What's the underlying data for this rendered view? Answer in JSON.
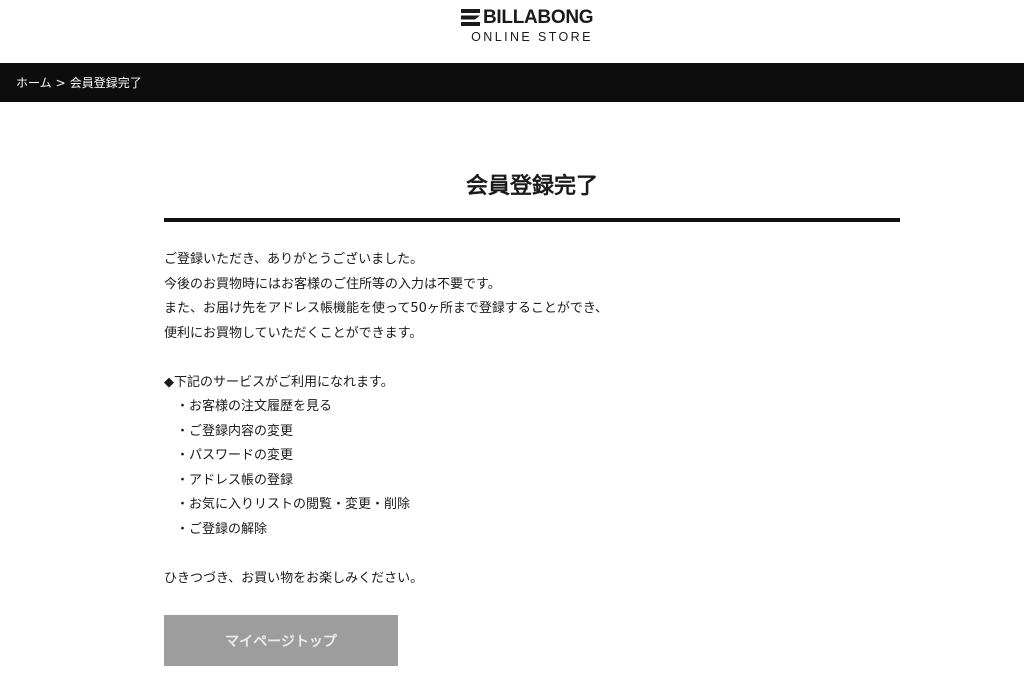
{
  "header": {
    "logo_name": "BILLABONG",
    "logo_sub": "ONLINE STORE"
  },
  "breadcrumb": {
    "home": "ホーム",
    "separator": ">",
    "current": "会員登録完了"
  },
  "main": {
    "title": "会員登録完了",
    "intro_lines": [
      "ご登録いただき、ありがとうございました。",
      "今後のお買物時にはお客様のご住所等の入力は不要です。",
      "また、お届け先をアドレス帳機能を使って50ヶ所まで登録することができ、",
      "便利にお買物していただくことができます。"
    ],
    "services_heading": "◆下記のサービスがご利用になれます。",
    "services": [
      "・お客様の注文履歴を見る",
      "・ご登録内容の変更",
      "・パスワードの変更",
      "・アドレス帳の登録",
      "・お気に入りリストの閲覧・変更・削除",
      "・ご登録の解除"
    ],
    "closing": "ひきつづき、お買い物をお楽しみください。",
    "button_label": "マイページトップ"
  },
  "colors": {
    "breadcrumb_bg": "#0d0d0d",
    "button_bg": "#9d9d9d",
    "button_text": "#ececec",
    "rule": "#111111"
  }
}
